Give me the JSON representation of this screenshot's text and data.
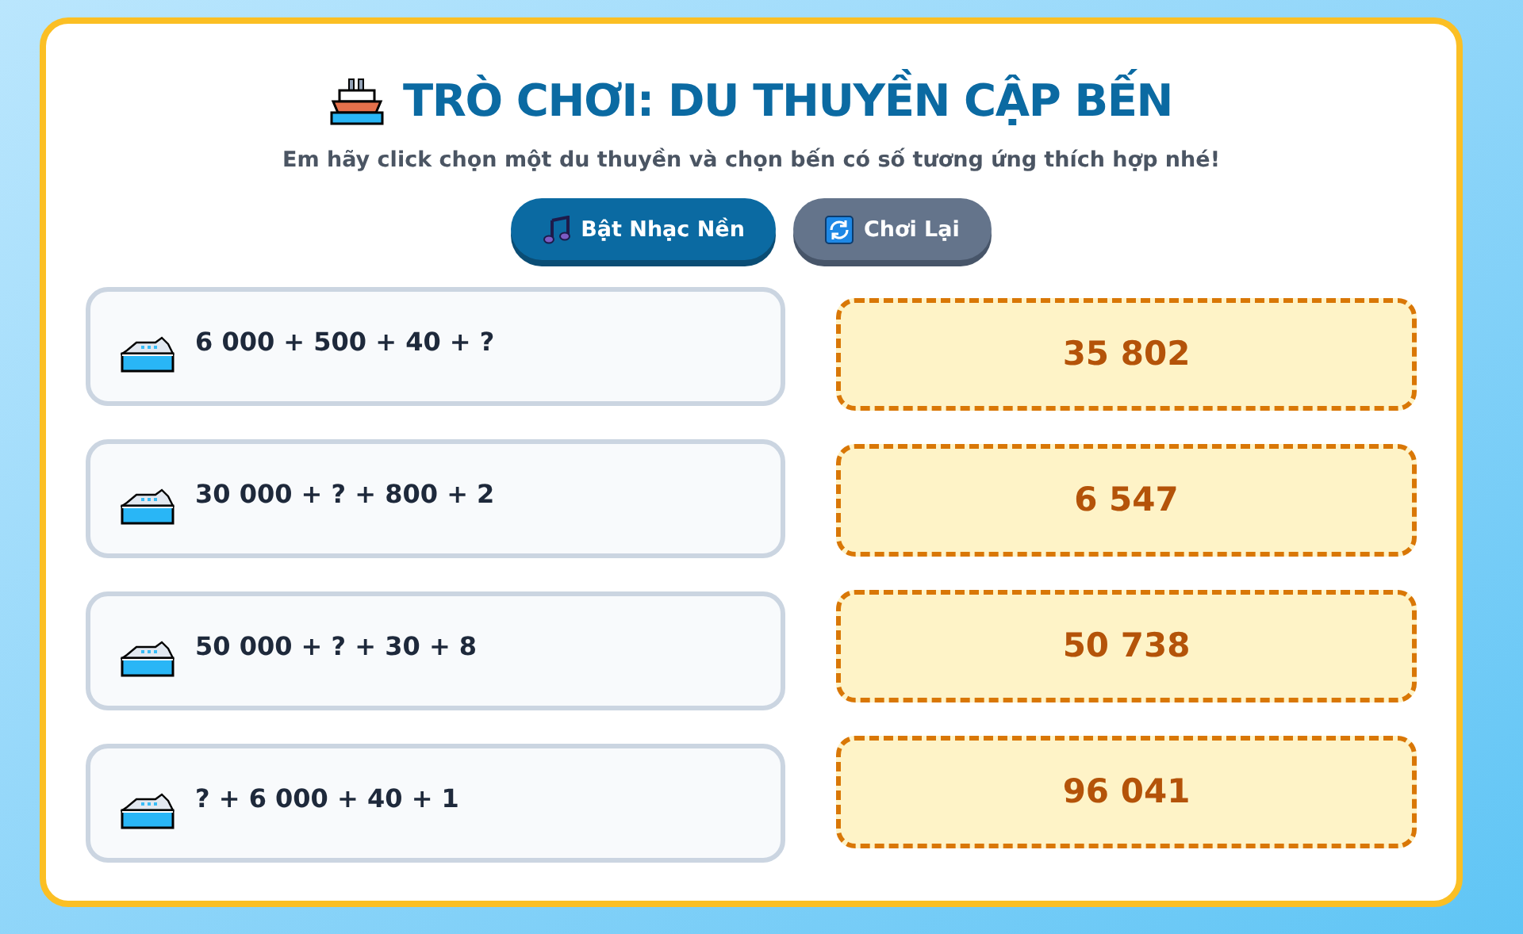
{
  "title": "TRÒ CHƠI: DU THUYỀN CẬP BẾN",
  "subtitle": "Em hãy click chọn một du thuyền và chọn bến có số tương ứng thích hợp nhé!",
  "buttons": [
    {
      "kind": "music",
      "label": "Bật Nhạc Nền"
    },
    {
      "kind": "replay",
      "label": "Chơi Lại"
    }
  ],
  "boats": [
    {
      "expression": "6 000 + 500 + 40 + ?"
    },
    {
      "expression": "30 000 + ? + 800 + 2"
    },
    {
      "expression": "50 000 + ? + 30 + 8"
    },
    {
      "expression": "? + 6 000 + 40 + 1"
    }
  ],
  "docks": [
    {
      "number": "35 802"
    },
    {
      "number": "6 547"
    },
    {
      "number": "50 738"
    },
    {
      "number": "96 041"
    }
  ]
}
